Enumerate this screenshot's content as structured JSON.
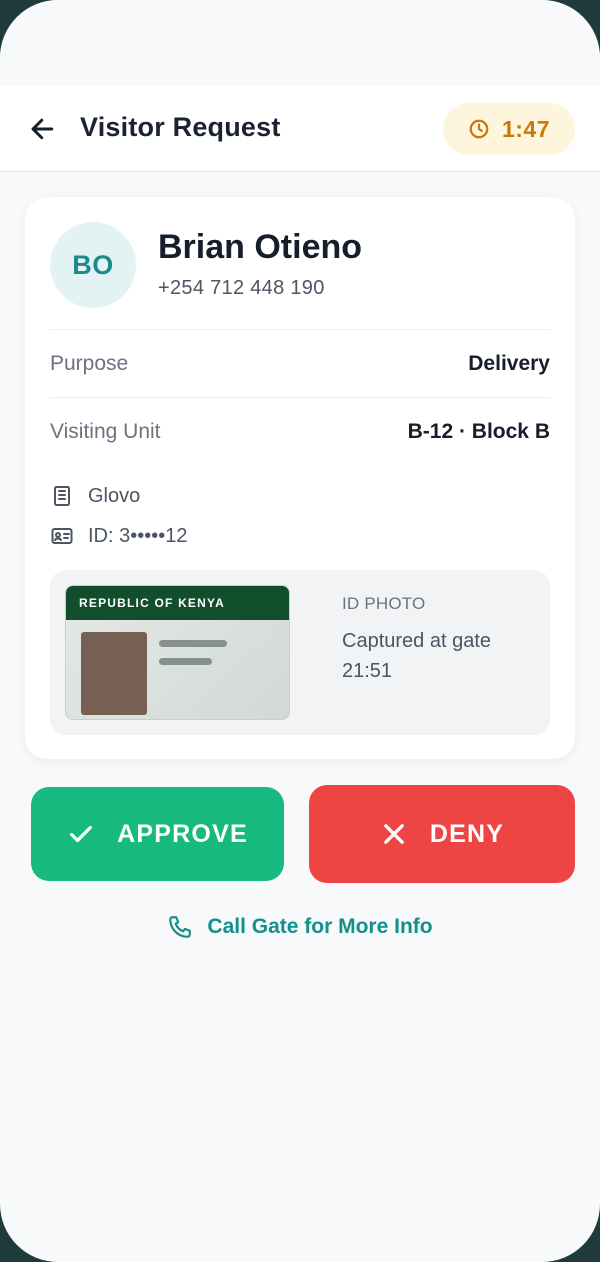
{
  "header": {
    "title": "Visitor Request",
    "timer": "1:47",
    "back_icon": "arrow-left-icon",
    "timer_icon": "clock-icon"
  },
  "visitor": {
    "initials": "BO",
    "name": "Brian Otieno",
    "phone": "+254 712 448 190"
  },
  "details": [
    {
      "label": "Purpose",
      "value": "Delivery"
    },
    {
      "label": "Visiting Unit",
      "value": "B-12 · Block B"
    }
  ],
  "meta": {
    "company": "Glovo",
    "company_icon": "building-icon",
    "id_text": "ID: 3•••••12",
    "id_icon": "id-card-icon"
  },
  "id_photo": {
    "card_header": "REPUBLIC OF KENYA",
    "label": "ID PHOTO",
    "caption_line1": "Captured at gate",
    "caption_line2": "21:51"
  },
  "actions": {
    "approve_label": "APPROVE",
    "deny_label": "DENY",
    "call_label": "Call Gate for More Info"
  },
  "colors": {
    "accent_teal": "#13908c",
    "approve_green": "#17b97f",
    "deny_red": "#ef4444",
    "timer_amber": "#c9780a"
  }
}
